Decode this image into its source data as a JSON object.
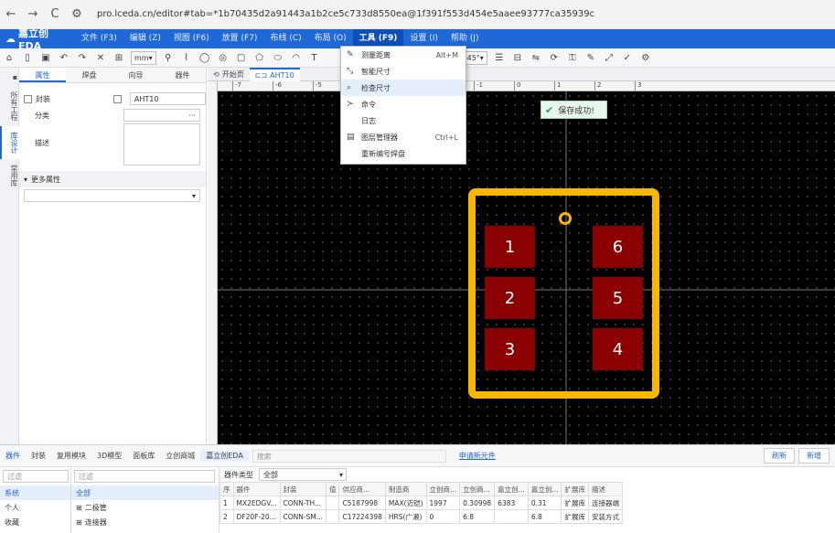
{
  "browser": {
    "back": "←",
    "forward": "→",
    "reload": "C",
    "url": "pro.lceda.cn/editor#tab=*1b70435d2a91443a1b2ce5c733d8550ea@1f391f553d454e5aaee93777ca35939c"
  },
  "app": {
    "logo": "嘉立创EDA"
  },
  "menu": [
    "文件 (F3)",
    "编辑 (Z)",
    "视图 (F6)",
    "放置 (F7)",
    "布线 (C)",
    "布局 (O)",
    "工具 (F9)",
    "设置 (I)",
    "帮助 (J)"
  ],
  "toolbar": {
    "unit": "mm",
    "angle": "45°"
  },
  "left_tabs": [
    "所有工程",
    "库设计",
    "常用库"
  ],
  "panel": {
    "tabs": [
      "属性",
      "焊盘",
      "向导",
      "器件"
    ],
    "footprint_label": "封装",
    "footprint_value": "AHT10",
    "category_label": "分类",
    "category_btn": "···",
    "desc_label": "描述",
    "more_props": "更多属性"
  },
  "doc_tabs": {
    "start": "开始页",
    "current": "AHT10"
  },
  "ruler_h": [
    "-7",
    "-6",
    "-5",
    "-4",
    "-3",
    "-2",
    "-1",
    "0",
    "1",
    "2",
    "3"
  ],
  "tools_menu": [
    {
      "label": "测量距离",
      "shortcut": "Alt+M",
      "icon": "ruler-icon"
    },
    {
      "label": "智能尺寸",
      "shortcut": "",
      "icon": "dimension-icon"
    },
    {
      "label": "检查尺寸",
      "shortcut": "",
      "icon": "check-dimension-icon"
    },
    {
      "label": "命令",
      "shortcut": "",
      "icon": "terminal-icon"
    },
    {
      "label": "日志",
      "shortcut": "",
      "icon": "log-icon"
    },
    {
      "label": "图层管理器",
      "shortcut": "Ctrl+L",
      "icon": "layers-icon"
    },
    {
      "label": "重新编号焊盘",
      "shortcut": "",
      "icon": "renumber-icon"
    }
  ],
  "toast": {
    "text": "保存成功!"
  },
  "pads": [
    {
      "num": "1",
      "col": "left",
      "row": 0
    },
    {
      "num": "2",
      "col": "left",
      "row": 1
    },
    {
      "num": "3",
      "col": "left",
      "row": 2
    },
    {
      "num": "6",
      "col": "right",
      "row": 0
    },
    {
      "num": "5",
      "col": "right",
      "row": 1
    },
    {
      "num": "4",
      "col": "right",
      "row": 2
    }
  ],
  "colors": {
    "accent": "#1f68d8",
    "silk": "#f7b600",
    "pad": "#8b0000"
  },
  "bottom": {
    "tabs": [
      "器件",
      "封装",
      "复用模块",
      "3D模型",
      "面板库",
      "立创商城",
      "嘉立创EDA"
    ],
    "search_placeholder": "搜索",
    "apply_link": "申请新元件",
    "refresh": "刷新",
    "new": "新增",
    "filter_placeholder": "过滤",
    "lib_list": [
      "系统",
      "个人",
      "收藏"
    ],
    "tree": [
      "全部",
      "二极管",
      "连接器"
    ],
    "type_label": "器件类型",
    "type_value": "全部",
    "headers": [
      "序",
      "器件",
      "封装",
      "值",
      "供应商...",
      "制造商",
      "立创商...",
      "立创商...",
      "嘉立创...",
      "嘉立创...",
      "扩展库",
      "描述"
    ],
    "rows": [
      [
        "1",
        "MX2EDGV...",
        "CONN-TH...",
        "",
        "C5187998",
        "MAX(迈铠)",
        "1997",
        "0.30998",
        "6383",
        "0.31",
        "扩展库",
        "连接器端"
      ],
      [
        "2",
        "DF20F-20...",
        "CONN-SM...",
        "",
        "C17224398",
        "HRS(广濑)",
        "0",
        "6.8",
        "",
        "6.8",
        "扩展库",
        "安装方式"
      ]
    ]
  }
}
